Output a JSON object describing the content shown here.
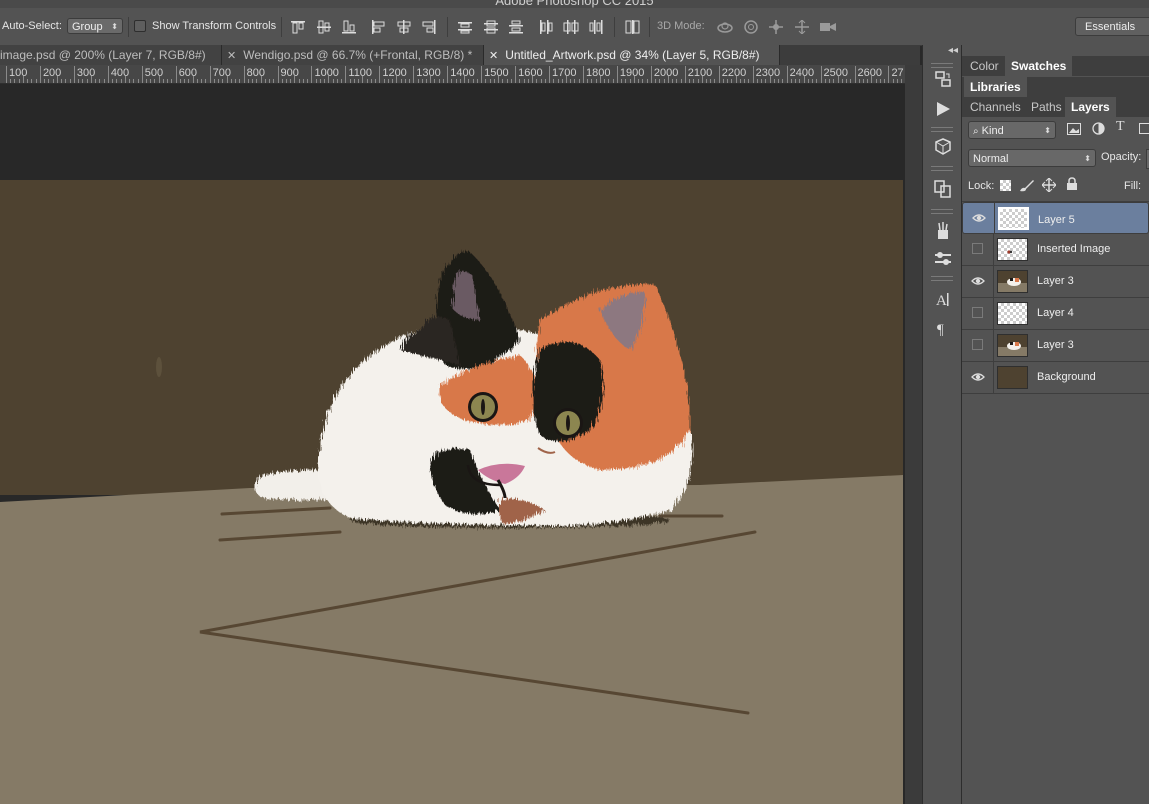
{
  "app": {
    "title": "Adobe Photoshop CC 2015"
  },
  "options_bar": {
    "auto_select_label": "Auto-Select:",
    "auto_select_value": "Group",
    "show_transform_label": "Show Transform Controls",
    "mode_3d_label": "3D Mode:",
    "workspace": "Essentials"
  },
  "tabs": [
    {
      "label": "image.psd @ 200% (Layer 7, RGB/8#)"
    },
    {
      "label": "Wendigo.psd @ 66.7% (+Frontal, RGB/8) *"
    },
    {
      "label": "Untitled_Artwork.psd @ 34% (Layer 5, RGB/8#)"
    }
  ],
  "ruler": {
    "labels": [
      "100",
      "200",
      "300",
      "400",
      "500",
      "600",
      "700",
      "800",
      "900",
      "1000",
      "1100",
      "1200",
      "1300",
      "1400",
      "1500",
      "1600",
      "1700",
      "1800",
      "1900",
      "2000",
      "2100",
      "2200",
      "2300",
      "2400",
      "2500",
      "2600",
      "27"
    ]
  },
  "panel": {
    "top_tabs": [
      "Color",
      "Swatches"
    ],
    "libraries_tab": "Libraries",
    "layer_tabs": [
      "Channels",
      "Paths",
      "Layers"
    ],
    "kind_filter": "Kind",
    "blend_mode": "Normal",
    "opacity_label": "Opacity:",
    "lock_label": "Lock:",
    "fill_label": "Fill:",
    "layers": [
      {
        "name": "Layer 5",
        "visible": true,
        "selected": true,
        "thumb": "transparent"
      },
      {
        "name": "Inserted Image",
        "visible": false,
        "selected": false,
        "thumb": "transparent-dot"
      },
      {
        "name": "Layer 3",
        "visible": true,
        "selected": false,
        "thumb": "scene"
      },
      {
        "name": "Layer 4",
        "visible": false,
        "selected": false,
        "thumb": "transparent"
      },
      {
        "name": "Layer 3",
        "visible": false,
        "selected": false,
        "thumb": "scene"
      },
      {
        "name": "Background",
        "visible": true,
        "selected": false,
        "thumb": "solid"
      }
    ]
  },
  "colors": {
    "wall": "#4e4230",
    "table": "#857a66",
    "calico_orange": "#d8784a",
    "calico_black": "#1e1a18",
    "selection": "#6b7f9e"
  },
  "icons": [
    "eye-icon",
    "search-icon",
    "image-filter-icon",
    "adjustment-filter-icon",
    "type-filter-icon",
    "shape-filter-icon",
    "lock-transparent-icon",
    "lock-paint-icon",
    "lock-move-icon",
    "lock-all-icon"
  ]
}
